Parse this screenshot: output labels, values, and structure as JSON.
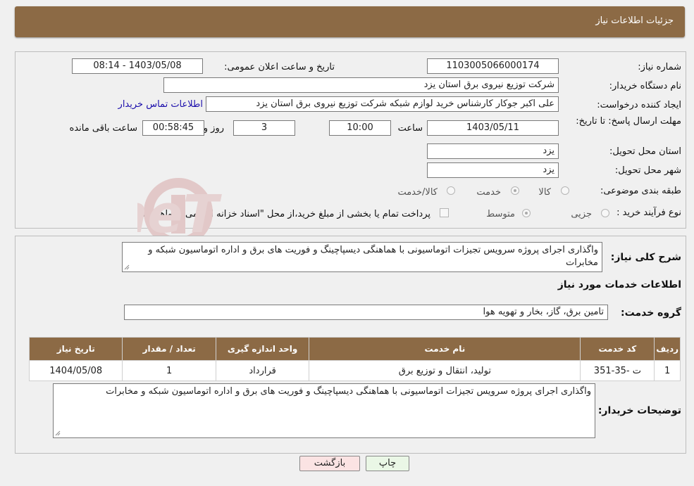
{
  "header": {
    "title": "جزئیات اطلاعات نیاز"
  },
  "form": {
    "need_number_label": "شماره نیاز:",
    "need_number": "1103005066000174",
    "announce_label": "تاریخ و ساعت اعلان عمومی:",
    "announce_value": "1403/05/08 - 08:14",
    "buyer_label": "نام دستگاه خریدار:",
    "buyer_value": "شرکت توزیع نیروی برق استان یزد",
    "creator_label": "ایجاد کننده درخواست:",
    "creator_value": "علی اکبر  جوکار  کارشناس خرید لوازم شبکه  شرکت توزیع نیروی برق استان یزد",
    "contact_link": "اطلاعات تماس خریدار",
    "deadline_label": "مهلت ارسال پاسخ: تا تاریخ:",
    "deadline_date": "1403/05/11",
    "time_label": "ساعت",
    "deadline_time": "10:00",
    "days_value": "3",
    "days_label": "روز و",
    "remaining_value": "00:58:45",
    "remaining_label": "ساعت باقی مانده",
    "province_label": "استان محل تحویل:",
    "province_value": "یزد",
    "city_label": "شهر محل تحویل:",
    "city_value": "یزد",
    "category_label": "طبقه بندی موضوعی:",
    "category_options": [
      "کالا",
      "خدمت",
      "کالا/خدمت"
    ],
    "process_label": "نوع فرآیند خرید :",
    "process_options": [
      "جزیی",
      "متوسط"
    ],
    "payment_note": "پرداخت تمام یا بخشی از مبلغ خرید،از محل \"اسناد خزانه اسلامی\" خواهد بود."
  },
  "summary": {
    "label": "شرح کلی نیاز:",
    "text": "واگذاری اجرای پروژه سرویس تجیزات اتوماسیونی با هماهنگی دیسپاچینگ و فوریت های برق  و اداره اتوماسیون شبکه و مخابرات"
  },
  "services": {
    "title": "اطلاعات خدمات مورد نیاز",
    "group_label": "گروه خدمت:",
    "group_value": "تامین برق، گاز، بخار و تهویه هوا",
    "columns": [
      "ردیف",
      "کد خدمت",
      "نام خدمت",
      "واحد اندازه گیری",
      "تعداد / مقدار",
      "تاریخ نیاز"
    ],
    "rows": [
      [
        "1",
        "ت -35-351",
        "تولید، انتقال و توزیع برق",
        "قرارداد",
        "1",
        "1404/05/08"
      ]
    ]
  },
  "buyer_notes": {
    "label": "توضیحات خریدار:",
    "text": "واگذاری اجرای پروژه سرویس تجیزات اتوماسیونی با هماهنگی دیسپاچینگ و فوریت های برق  و اداره اتوماسیون شبکه و مخابرات"
  },
  "buttons": {
    "print": "چاپ",
    "back": "بازگشت"
  },
  "watermark": {
    "text": "AriaTender.neT"
  }
}
